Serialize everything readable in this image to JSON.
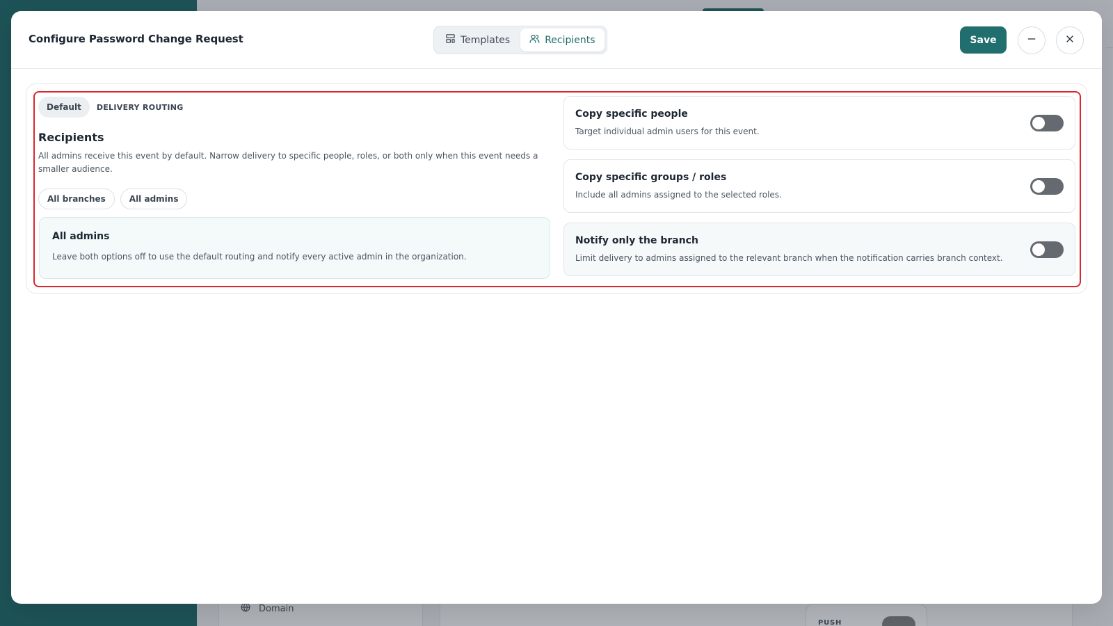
{
  "background": {
    "sidebar_item_label": "Domain",
    "push_label": "PUSH"
  },
  "modal": {
    "title": "Configure Password Change Request",
    "tabs": [
      {
        "label": "Templates",
        "icon": "layout-template-icon",
        "active": false
      },
      {
        "label": "Recipients",
        "icon": "users-icon",
        "active": true
      }
    ],
    "save_label": "Save"
  },
  "routing": {
    "chip_label": "Default",
    "eyebrow": "DELIVERY ROUTING",
    "title": "Recipients",
    "description": "All admins receive this event by default. Narrow delivery to specific people, roles, or both only when this event needs a smaller audience.",
    "pills": [
      "All branches",
      "All admins"
    ],
    "summary": {
      "title": "All admins",
      "description": "Leave both options off to use the default routing and notify every active admin in the organization."
    }
  },
  "options": [
    {
      "title": "Copy specific people",
      "description": "Target individual admin users for this event.",
      "enabled": false
    },
    {
      "title": "Copy specific groups / roles",
      "description": "Include all admins assigned to the selected roles.",
      "enabled": false
    },
    {
      "title": "Notify only the branch",
      "description": "Limit delivery to admins assigned to the relevant branch when the notification carries branch context.",
      "enabled": false
    }
  ],
  "colors": {
    "accent": "#206e6d",
    "highlight_border": "#d9262c",
    "sidebar": "#1d5358"
  }
}
